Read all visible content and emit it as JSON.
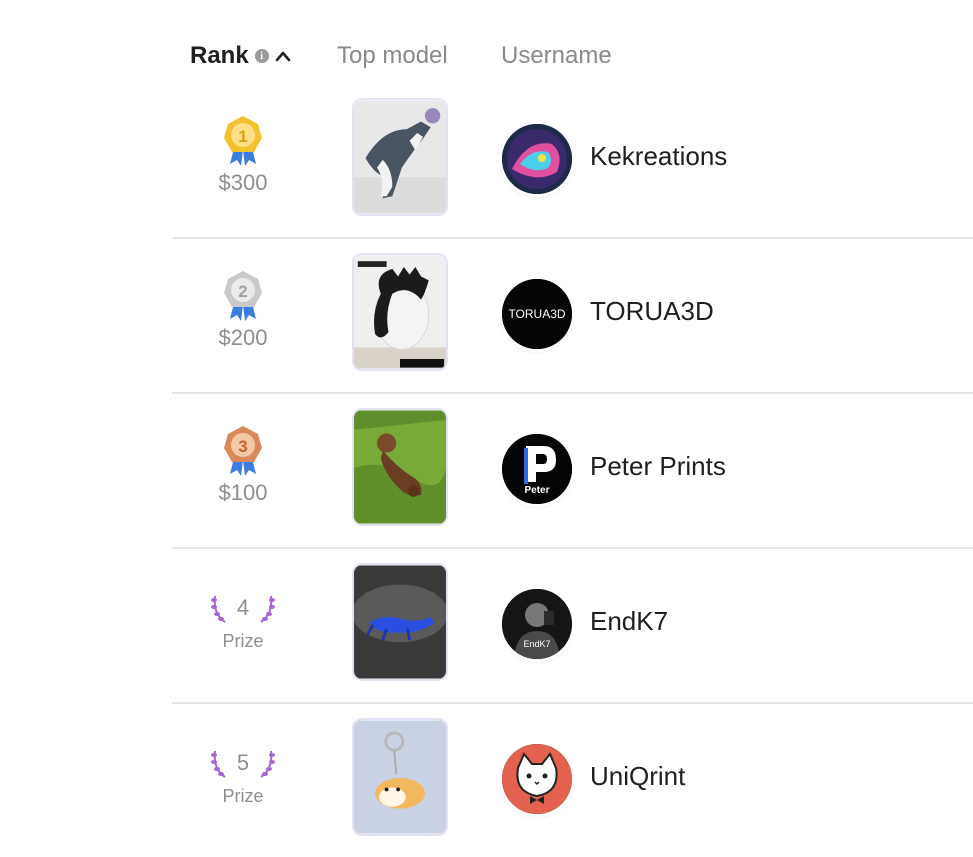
{
  "header": {
    "rank_label": "Rank",
    "top_model_label": "Top model",
    "username_label": "Username"
  },
  "rows": [
    {
      "rank": "1",
      "prize": "$300",
      "medal_color": "#f2c12e",
      "username": "Kekreations",
      "avatar_text": ""
    },
    {
      "rank": "2",
      "prize": "$200",
      "medal_color": "#c9c9c9",
      "username": "TORUA3D",
      "avatar_text": "TORUA3D"
    },
    {
      "rank": "3",
      "prize": "$100",
      "medal_color": "#d9895a",
      "username": "Peter Prints",
      "avatar_text": "Peter"
    },
    {
      "rank": "4",
      "prize": "Prize",
      "medal_color": "#9b59c9",
      "username": "EndK7",
      "avatar_text": "EndK7"
    },
    {
      "rank": "5",
      "prize": "Prize",
      "medal_color": "#9b59c9",
      "username": "UniQrint",
      "avatar_text": ""
    }
  ],
  "colors": {
    "ribbon": "#3b7de0",
    "laurel": "#a566d6",
    "divider": "#e6e6e6"
  }
}
